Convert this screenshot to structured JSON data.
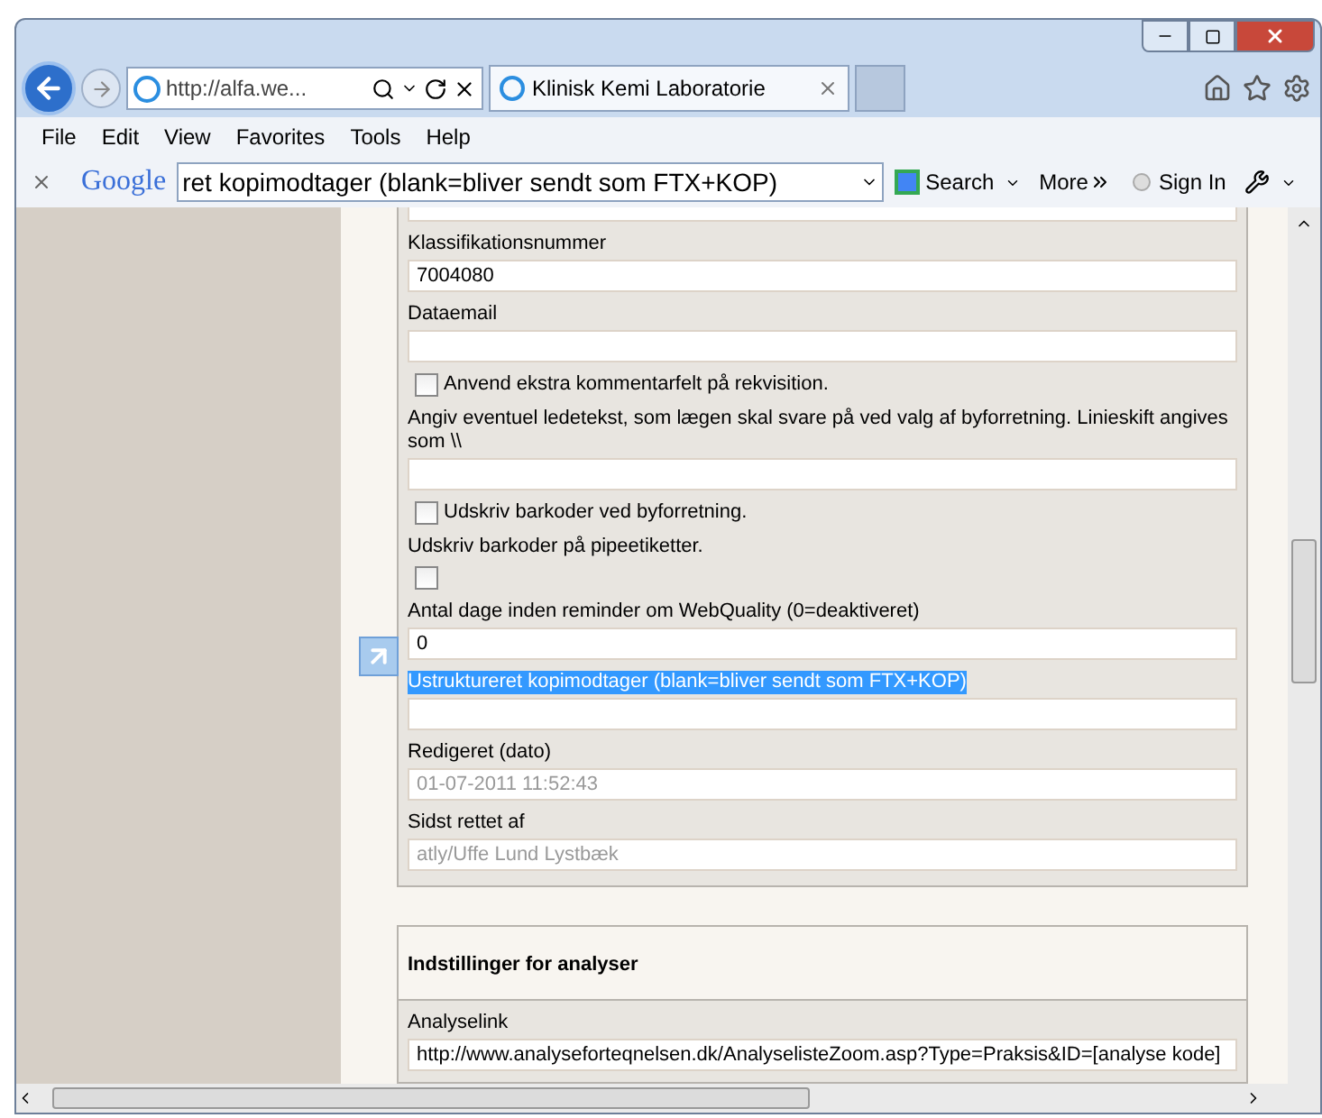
{
  "browser": {
    "address": "http://alfa.we...",
    "tabs": [
      {
        "label": "Klinisk Kemi Laboratorie",
        "selected": true
      }
    ],
    "menu": [
      "File",
      "Edit",
      "View",
      "Favorites",
      "Tools",
      "Help"
    ]
  },
  "google_toolbar": {
    "brand": "Google",
    "query": "ret kopimodtager (blank=bliver sendt som FTX+KOP)",
    "search": "Search",
    "more": "More",
    "sign_in": "Sign In"
  },
  "form": {
    "fields": [
      {
        "kind": "text",
        "label": "Klassifikationsnummer",
        "value": "7004080",
        "highlighted": false
      },
      {
        "kind": "text",
        "label": "Dataemail",
        "highlighted": false
      },
      {
        "kind": "checkbox",
        "label": "Anvend ekstra kommentarfelt på rekvisition.",
        "checked": false
      },
      {
        "kind": "text",
        "label": "Angiv eventuel ledetekst, som lægen skal svare på ved valg af byforretning. Linieskift angives som \\\\",
        "highlighted": false
      },
      {
        "kind": "checkbox",
        "label": "Udskriv barkoder ved byforretning.",
        "checked": false
      },
      {
        "kind": "checkbox_below",
        "label": "Udskriv barkoder på pipeetiketter.",
        "checked": false
      },
      {
        "kind": "text",
        "label": "Antal dage inden reminder om WebQuality (0=deaktiveret)",
        "value": "0",
        "highlighted": false
      },
      {
        "kind": "text",
        "label": "Ustruktureret kopimodtager (blank=bliver sendt som FTX+KOP)",
        "highlighted": true
      },
      {
        "kind": "text",
        "label": "Redigeret (dato)",
        "value": "01-07-2011 11:52:43",
        "disabled": true,
        "highlighted": false
      },
      {
        "kind": "text",
        "label": "Sidst rettet af",
        "value": "atly/Uffe Lund Lystbæk",
        "disabled": true,
        "highlighted": false
      }
    ]
  },
  "section": {
    "title": "Indstillinger for analyser",
    "fields": [
      {
        "kind": "text",
        "label": "Analyselink",
        "value": "http://www.analyseforteqnelsen.dk/AnalyselisteZoom.asp?Type=Praksis&ID=[analyse kode]",
        "highlighted": false
      }
    ]
  }
}
